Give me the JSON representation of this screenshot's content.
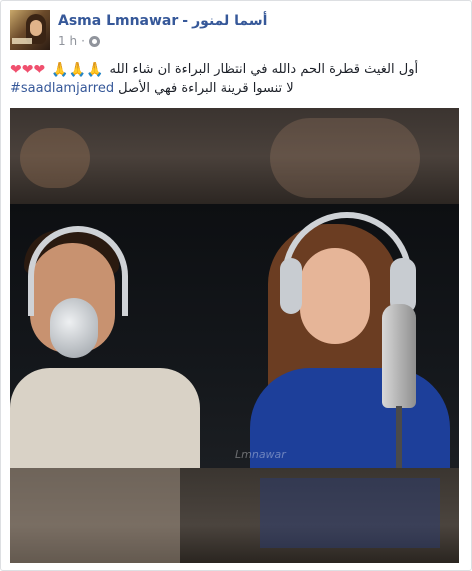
{
  "post": {
    "author_name": "Asma Lmnawar",
    "author_separator": "-",
    "author_name_arabic": "أسما لمنور",
    "time": "1 h",
    "time_dot": "·",
    "privacy_icon": "globe-icon",
    "caption_line1_emojis_hearts": "❤❤❤",
    "caption_line1_emojis_hands": "🙏🙏🙏",
    "caption_line1_text": "أول الغيث قطرة الحم دالله في انتظار البراءة ان شاء الله",
    "caption_line2_hashtag": "#saadlamjarred",
    "caption_line2_text": "لا تنسوا قرينة البراءة فهي الأصل",
    "media_watermark": "Lmnawar",
    "colors": {
      "link": "#365899",
      "meta": "#90949c",
      "heart": "#f0506e"
    }
  }
}
